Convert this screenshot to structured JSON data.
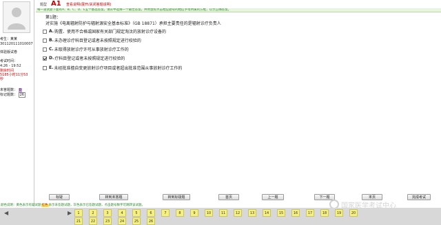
{
  "sidebar": {
    "student_label": "考生：某某",
    "exam_id": "30112011101000​7",
    "exam_type": "体验版试卷",
    "exam_time_label": "考试时间：",
    "exam_time_range": "4:26 - 19:52",
    "remaining_label": "剩余时间",
    "remaining_value": "5185小时11分53",
    "remaining_unit": "秒",
    "unanswered_label": "未答题数：",
    "unanswered_count": "0",
    "flagged_label": "标记题数：",
    "flagged_count": "26"
  },
  "header": {
    "topic_type_label": "题型",
    "topic_code": "A1",
    "help_text": "查看说明(展开/关闭答题说明)"
  },
  "instruction": "每一道试题下面有A、B、C、D、E五个备选答案，请从中选择一个最佳答案，并用鼠标点击相应题号的相应字母所属的方框，以示正确答案。",
  "question": {
    "number_label": "第1题：",
    "text": "对实施《电离辐射防护与辐射源安全基本标准》（GB 18871）承担主要责任的是辐射诊疗负责人",
    "options": [
      {
        "key": "A.",
        "text": "购置、使用不合格或国家有关部门规定淘汰的放射诊疗设备的",
        "checked": false
      },
      {
        "key": "B.",
        "text": "未办理诊疗科目登记或者未按照规定进行校验的",
        "checked": false
      },
      {
        "key": "C.",
        "text": "未取得放射诊疗许可从事放射诊疗工作的",
        "checked": false
      },
      {
        "key": "D.",
        "text": "疗科目登记或者未按照规定进行校验的",
        "checked": true
      },
      {
        "key": "E.",
        "text": "未经批准擅自变更放射诊疗项目或者超出批准范围从事放射诊疗工作的",
        "checked": false
      }
    ]
  },
  "buttons": {
    "flag": "标疑",
    "goto_unanswered": "转到未答题",
    "goto_flagged": "转到标疑题",
    "first": "首页",
    "prev": "上一题",
    "next": "下一题",
    "last": "末页",
    "finish": "完成考试"
  },
  "status": {
    "prefix": "颜色说明：黄色表示有疑试题",
    "highlight": "红色",
    "suffix": "表示未答题试题，灰色表示已答题试题，点击题号数字可跳转该试题。"
  },
  "grid": {
    "row1": [
      "1",
      "2",
      "3",
      "4",
      "5",
      "6",
      "7",
      "8",
      "9",
      "10",
      "11",
      "12",
      "13",
      "14",
      "15",
      "16",
      "17",
      "18",
      "19",
      "20"
    ],
    "row2": [
      "21",
      "22",
      "23",
      "24",
      "25",
      "26"
    ]
  },
  "watermark": "国家医学考试中心"
}
